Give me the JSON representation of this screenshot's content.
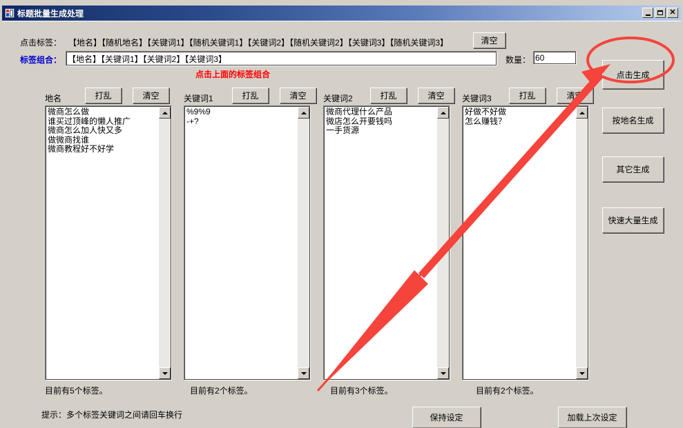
{
  "window": {
    "title": "标题批量生成处理",
    "icon": "app-icon",
    "buttons": {
      "minimize": "_",
      "maximize": "□",
      "close": "X"
    }
  },
  "toolbar": {
    "click_tag_label": "点击标签：",
    "tags": "【地名】【随机地名】【关键词1】【随机关键词1】【关键词2】【随机关键词2】【关键词3】【随机关键词3】",
    "clear_all_label": "清空",
    "combo_label": "标签组合：",
    "combo_value": "【地名】【关键词1】【关键词2】【关键词3】",
    "hint_red": "点击上面的标签组合",
    "quantity_label": "数量：",
    "quantity_value": "60"
  },
  "columns": [
    {
      "title": "地名",
      "shuffle_label": "打乱",
      "clear_label": "清空",
      "lines": "微商怎么做\n谁买过顶峰的懒人推广\n微商怎么加人快又多\n做微商找谁\n微商教程好不好学",
      "count_label": "目前有5个标签。"
    },
    {
      "title": "关键词1",
      "shuffle_label": "打乱",
      "clear_label": "清空",
      "lines": "%9%9\n-+?",
      "count_label": "目前有2个标签。"
    },
    {
      "title": "关键词2",
      "shuffle_label": "打乱",
      "clear_label": "清空",
      "lines": "微商代理什么产品\n微店怎么开要钱吗\n一手货源",
      "count_label": "目前有3个标签。"
    },
    {
      "title": "关键词3",
      "shuffle_label": "打乱",
      "clear_label": "清空",
      "lines": "好做不好做\n怎么赚钱？",
      "count_label": "目前有2个标签。"
    }
  ],
  "side_buttons": [
    {
      "label": "点击生成"
    },
    {
      "label": "按地名生成"
    },
    {
      "label": "其它生成"
    },
    {
      "label": "快速大量生成"
    }
  ],
  "footer": {
    "tip": "提示：多个标签关键词之间请回车换行",
    "save_label": "保持设定",
    "load_label": "加载上次设定"
  },
  "annotation": {
    "color": "#f4443c",
    "shape": "circle-and-arrow",
    "target": "点击生成"
  }
}
